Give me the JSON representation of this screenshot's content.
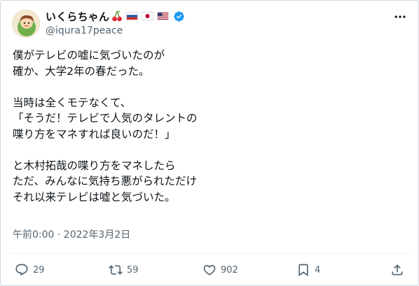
{
  "user": {
    "display_name": "いくらちゃん",
    "emoji_icons": [
      "cherry-icon",
      "russia-flag-icon",
      "japan-flag-icon",
      "usa-flag-icon",
      "verified-badge-icon"
    ],
    "handle": "@iqura17peace"
  },
  "post": {
    "text": "僕がテレビの嘘に気づいたのが\n確か、大学2年の春だった。\n\n当時は全くモテなくて、\n「そうだ！テレビで人気のタレントの\n喋り方をマネすれば良いのだ！」\n\nと木村拓哉の喋り方をマネしたら\nただ、みんなに気持ち悪がられただけ\nそれ以来テレビは嘘と気づいた。",
    "timestamp": "午前0:00 · 2022年3月2日"
  },
  "actions": {
    "reply_count": "29",
    "repost_count": "59",
    "like_count": "902",
    "bookmark_count": "4"
  },
  "colors": {
    "text": "#0f1419",
    "secondary": "#536471",
    "verified": "#1d9bf0",
    "border": "#cfd9de"
  }
}
